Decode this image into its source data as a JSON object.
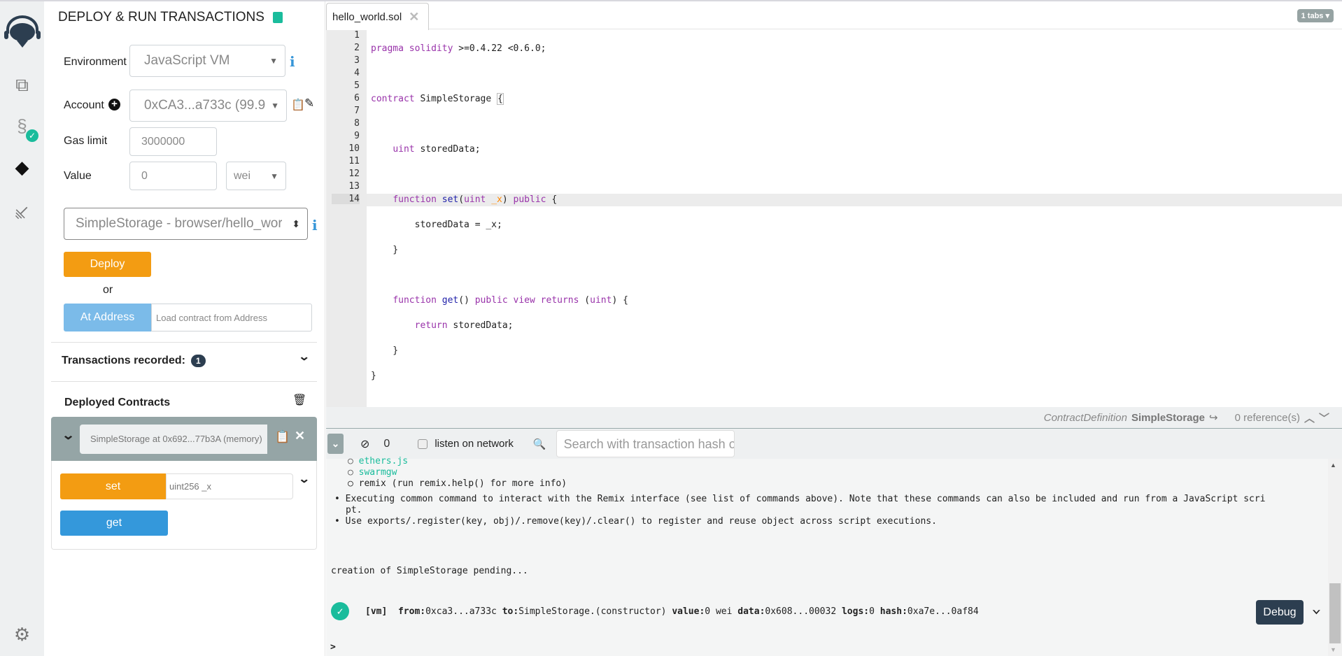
{
  "sidebar": {
    "icons": [
      "remix-logo-icon",
      "file-explorer-icon",
      "solidity-compiler-icon",
      "deploy-run-icon",
      "plugin-manager-icon",
      "settings-icon"
    ]
  },
  "panel": {
    "title": "DEPLOY & RUN TRANSACTIONS",
    "environment": {
      "label": "Environment",
      "value": "JavaScript VM"
    },
    "account": {
      "label": "Account",
      "value": "0xCA3...a733c (99.9"
    },
    "gas_limit": {
      "label": "Gas limit",
      "value": "3000000"
    },
    "value": {
      "label": "Value",
      "amount": "0",
      "unit": "wei"
    },
    "contract_select": "SimpleStorage - browser/hello_world",
    "deploy_label": "Deploy",
    "or_label": "or",
    "at_address_label": "At Address",
    "at_address_placeholder": "Load contract from Address",
    "transactions_recorded": {
      "label": "Transactions recorded:",
      "count": "1"
    },
    "deployed_contracts": {
      "label": "Deployed Contracts",
      "instance": {
        "name": "SimpleStorage at 0x692...77b3A (memory)",
        "functions": [
          {
            "label": "set",
            "placeholder": "uint256 _x",
            "color": "#f39c12"
          },
          {
            "label": "get",
            "color": "#3498db"
          }
        ]
      }
    }
  },
  "editor": {
    "tab": "hello_world.sol",
    "tabs_badge": "1 tabs",
    "line_numbers": [
      "1",
      "2",
      "3",
      "4",
      "5",
      "6",
      "7",
      "8",
      "9",
      "10",
      "11",
      "12",
      "13",
      "14"
    ],
    "active_line": 14
  },
  "status_bar": {
    "kind": "ContractDefinition",
    "name": "SimpleStorage",
    "references": "0 reference(s)"
  },
  "terminal": {
    "pending_count": "0",
    "listen_label": "listen on network",
    "search_placeholder": "Search with transaction hash or address",
    "lines": {
      "l0": "ethers.js",
      "l1": "swarmgw",
      "l2": "remix (run remix.help() for more info)",
      "l3": "Executing common command to interact with the Remix interface (see list of commands above). Note that these commands can also be included and run from a JavaScript scri",
      "l4": "pt.",
      "l5": "Use exports/.register(key, obj)/.remove(key)/.clear() to register and reuse object across script executions.",
      "pending": "creation of SimpleStorage pending..."
    },
    "tx": {
      "tag": "[vm]",
      "from_k": "from:",
      "from": "0xca3...a733c",
      "to_k": "to:",
      "to": "SimpleStorage.(constructor)",
      "value_k": "value:",
      "value": "0 wei",
      "data_k": "data:",
      "data": "0x608...00032",
      "logs_k": "logs:",
      "logs": "0",
      "hash_k": "hash:",
      "hash": "0xa7e...0af84"
    },
    "debug_label": "Debug",
    "prompt": ">"
  },
  "colors": {
    "deploy": "#f39c12",
    "at_address": "#7bbbe9",
    "success": "#1abc9c",
    "debug": "#2c3e50",
    "accent_teal": "#1abc9c"
  }
}
